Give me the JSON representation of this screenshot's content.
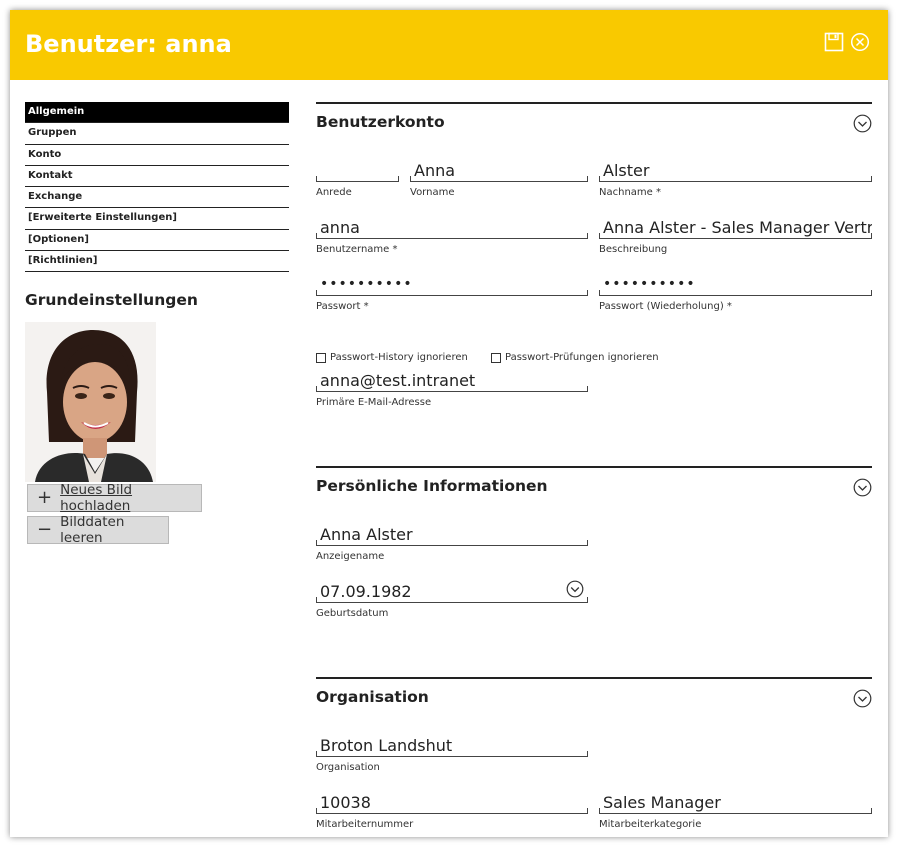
{
  "window": {
    "title": "Benutzer: anna",
    "icons": {
      "save": "save-icon",
      "close": "close-icon"
    },
    "accent_color": "#f9c900"
  },
  "sidebar": {
    "items": [
      {
        "label": "Allgemein",
        "active": true
      },
      {
        "label": "Gruppen"
      },
      {
        "label": "Konto"
      },
      {
        "label": "Kontakt"
      },
      {
        "label": "Exchange"
      },
      {
        "label": "[Erweiterte Einstellungen]"
      },
      {
        "label": "[Optionen]"
      },
      {
        "label": "[Richtlinien]"
      }
    ],
    "section_title": "Grundeinstellungen",
    "upload_button": "Neues Bild hochladen",
    "clear_button": "Bilddaten leeren"
  },
  "sections": {
    "account": {
      "title": "Benutzerkonto",
      "salutation": {
        "value": "",
        "label": "Anrede"
      },
      "firstname": {
        "value": "Anna",
        "label": "Vorname"
      },
      "lastname": {
        "value": "Alster",
        "label": "Nachname *"
      },
      "username": {
        "value": "anna",
        "label": "Benutzername *"
      },
      "description": {
        "value": "Anna Alster - Sales Manager Vertrieb",
        "label": "Beschreibung"
      },
      "password": {
        "value": "••••••••••",
        "label": "Passwort *"
      },
      "password_repeat": {
        "value": "••••••••••",
        "label": "Passwort (Wiederholung) *"
      },
      "ignore_history": "Passwort-History ignorieren",
      "ignore_checks": "Passwort-Prüfungen ignorieren",
      "email": {
        "value": "anna@test.intranet",
        "label": "Primäre E-Mail-Adresse"
      }
    },
    "personal": {
      "title": "Persönliche Informationen",
      "display_name": {
        "value": "Anna Alster",
        "label": "Anzeigename"
      },
      "birthdate": {
        "value": "07.09.1982",
        "label": "Geburtsdatum"
      }
    },
    "organisation": {
      "title": "Organisation",
      "organisation": {
        "value": "Broton Landshut",
        "label": "Organisation"
      },
      "employee_number": {
        "value": "10038",
        "label": "Mitarbeiternummer"
      },
      "employee_category": {
        "value": "Sales Manager",
        "label": "Mitarbeiterkategorie"
      }
    }
  }
}
